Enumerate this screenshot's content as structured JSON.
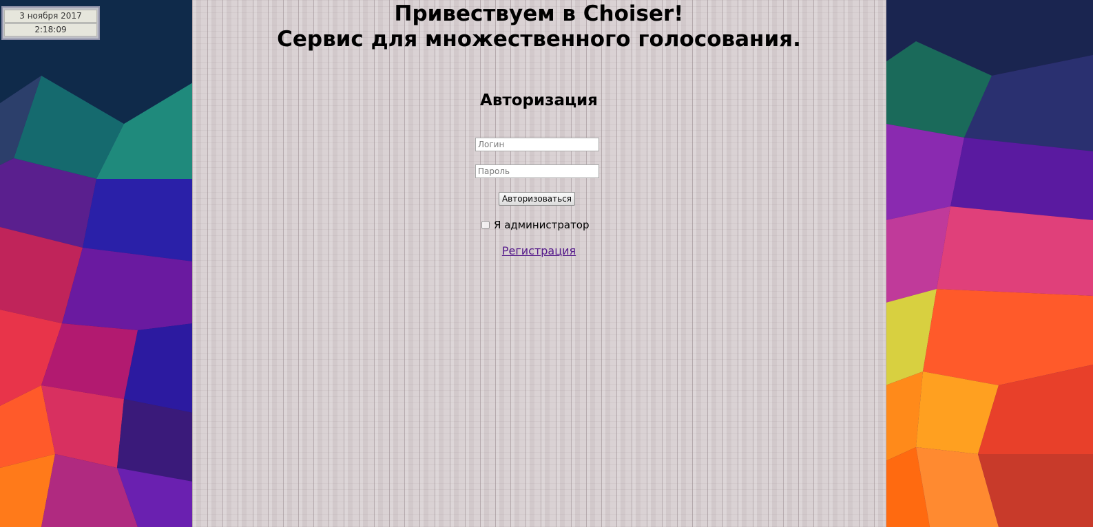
{
  "clock": {
    "date": "3 ноября 2017",
    "time": "2:18:09"
  },
  "header": {
    "line1": "Привествуем в Choiser!",
    "line2": "Сервис для множественного голосования."
  },
  "auth": {
    "title": "Авторизация",
    "login_placeholder": "Логин",
    "password_placeholder": "Пароль",
    "submit_label": "Авторизоваться",
    "admin_checkbox_label": "Я администратор",
    "admin_checked": false,
    "register_link": "Регистрация"
  },
  "colors": {
    "panel": "#d6cdcf",
    "link_visited": "#551a8b"
  }
}
